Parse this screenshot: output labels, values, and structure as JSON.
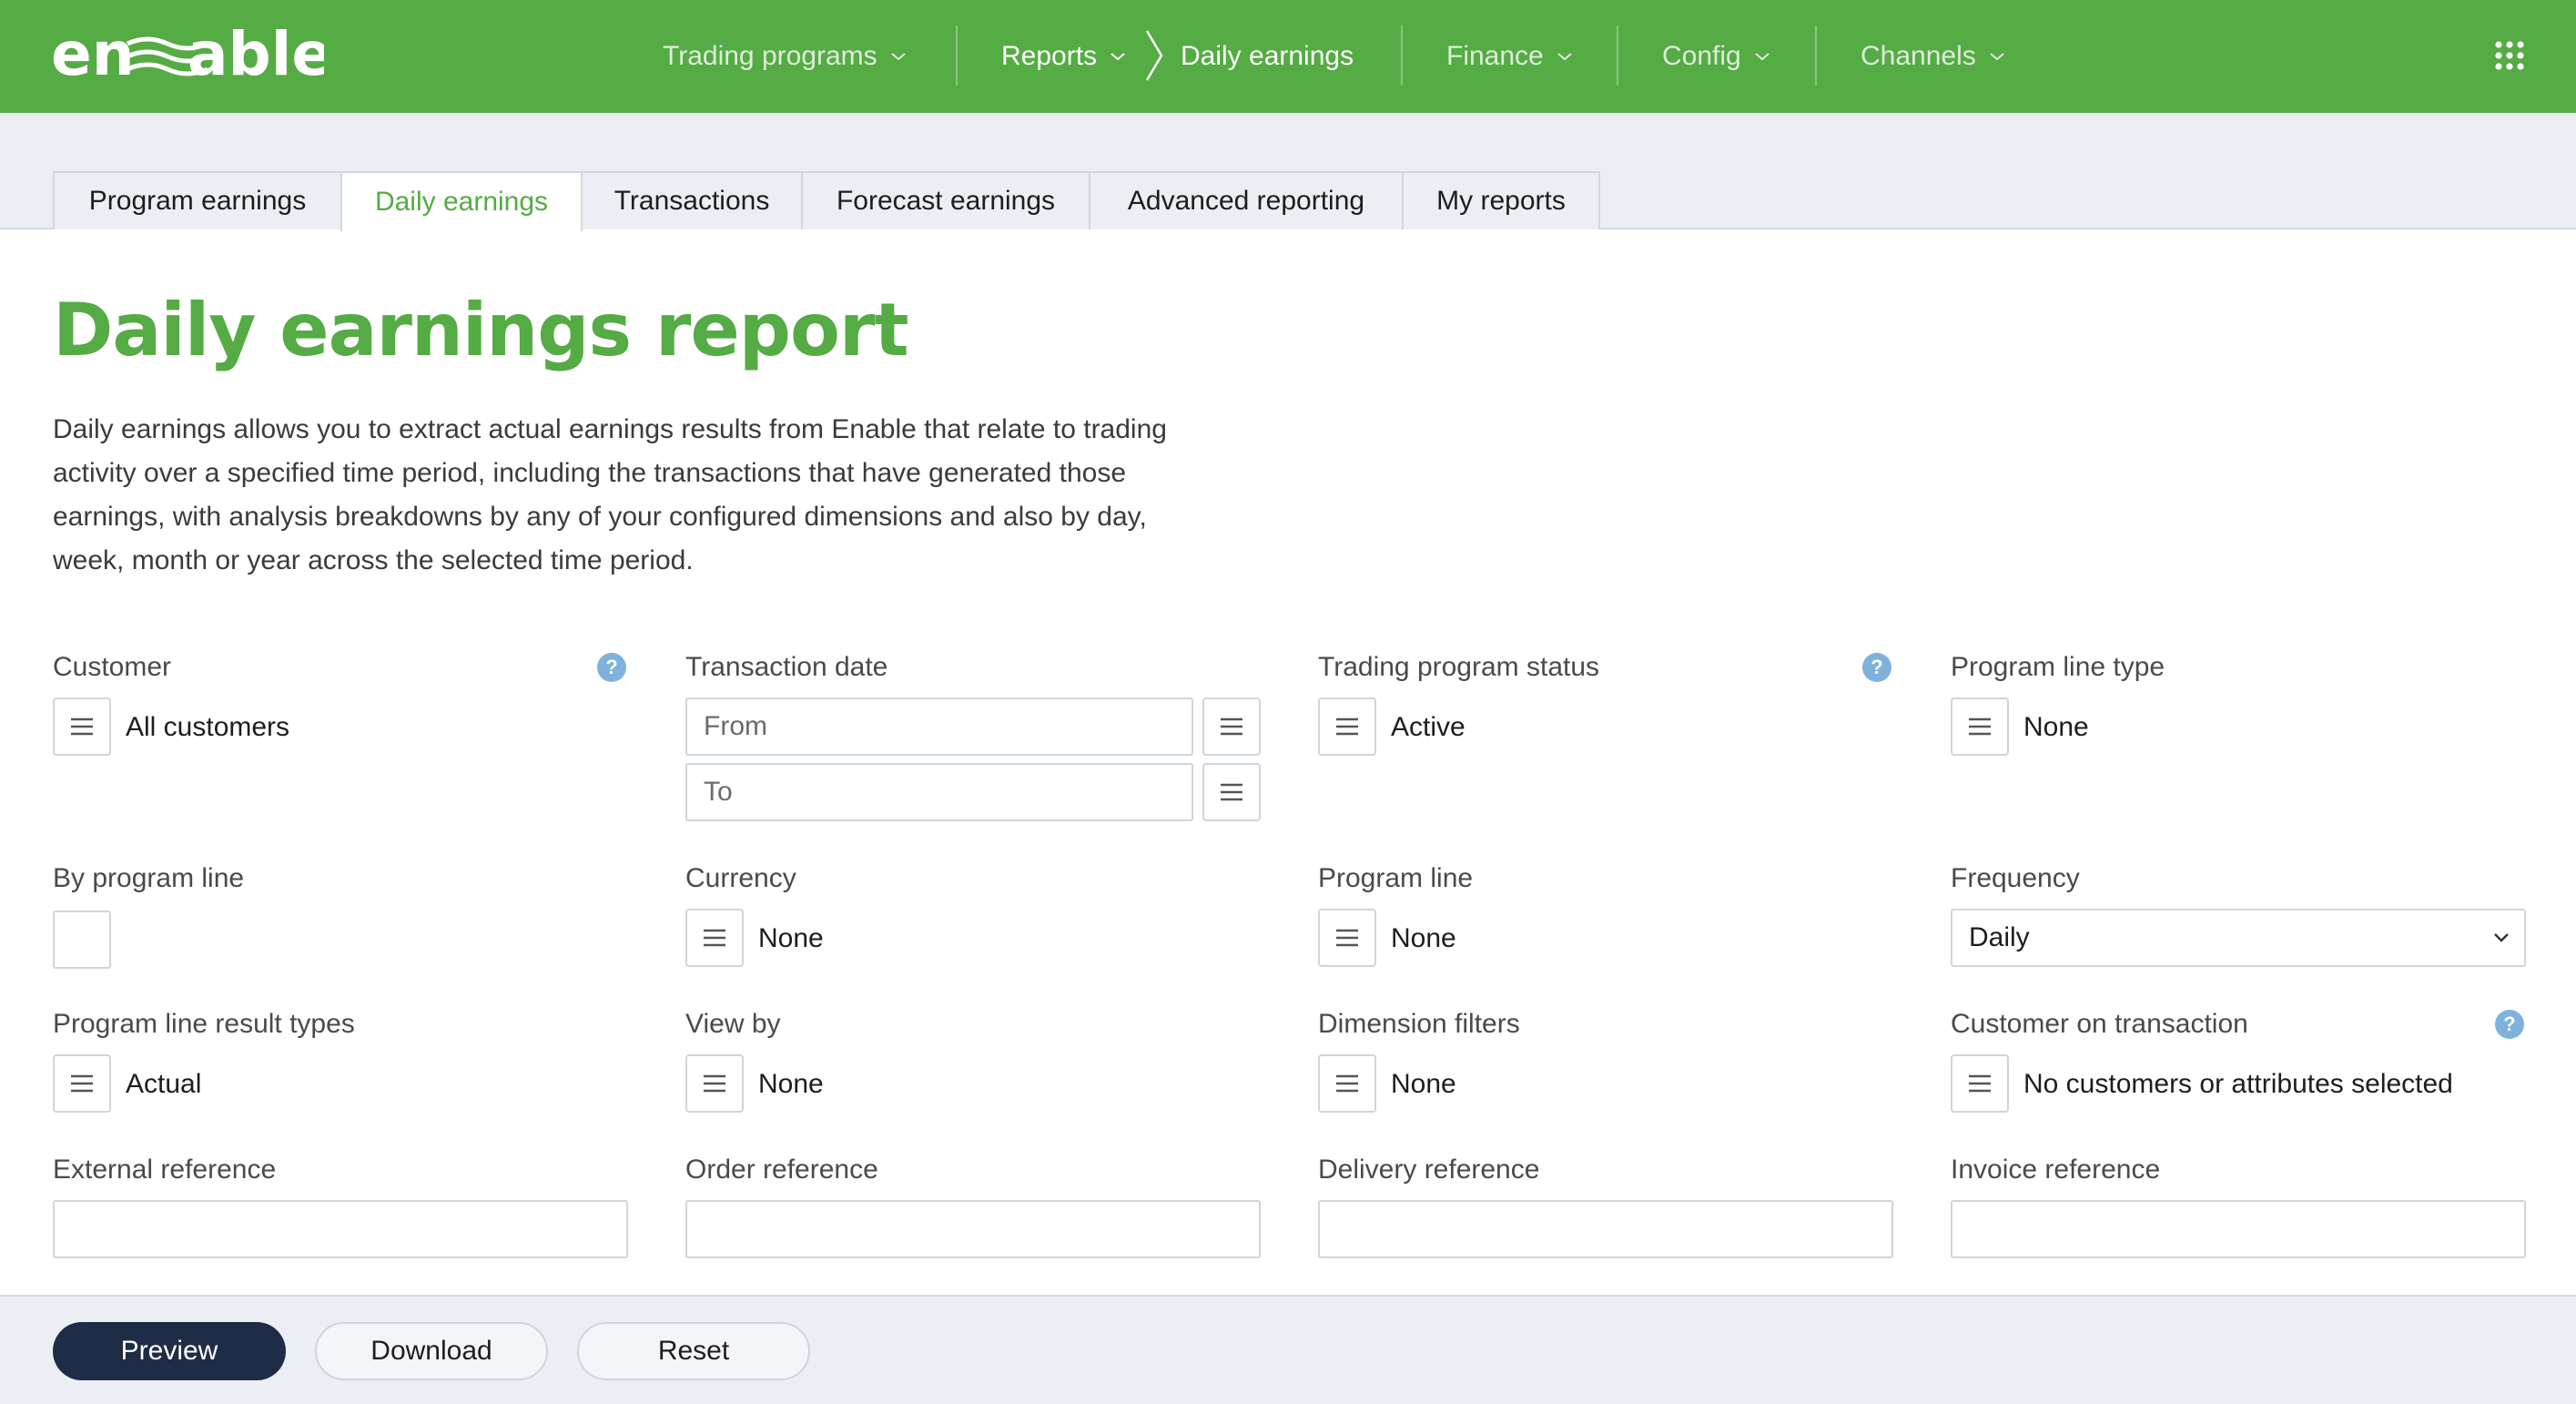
{
  "brand": {
    "name": "enable",
    "color": "#55ab44"
  },
  "nav": {
    "trading_programs": "Trading programs",
    "reports": "Reports",
    "current": "Daily earnings",
    "finance": "Finance",
    "config": "Config",
    "channels": "Channels",
    "apps_icon": "grid-icon"
  },
  "tabs": [
    {
      "label": "Program earnings"
    },
    {
      "label": "Daily earnings",
      "active": true
    },
    {
      "label": "Transactions"
    },
    {
      "label": "Forecast earnings"
    },
    {
      "label": "Advanced reporting"
    },
    {
      "label": "My reports"
    }
  ],
  "page": {
    "title": "Daily earnings report",
    "description": "Daily earnings allows you to extract actual earnings results from Enable that relate to trading activity over a specified time period, including the transactions that have generated those earnings, with analysis breakdowns by any of your configured dimensions and also by day, week, month or year across the selected time period."
  },
  "form": {
    "customer": {
      "label": "Customer",
      "value": "All customers"
    },
    "transaction_date": {
      "label": "Transaction date",
      "from_placeholder": "From",
      "to_placeholder": "To"
    },
    "trading_program_status": {
      "label": "Trading program status",
      "value": "Active"
    },
    "program_line_type": {
      "label": "Program line type",
      "value": "None"
    },
    "by_program_line": {
      "label": "By program line"
    },
    "currency": {
      "label": "Currency",
      "value": "None"
    },
    "program_line": {
      "label": "Program line",
      "value": "None"
    },
    "frequency": {
      "label": "Frequency",
      "value": "Daily"
    },
    "program_line_result_types": {
      "label": "Program line result types",
      "value": "Actual"
    },
    "view_by": {
      "label": "View by",
      "value": "None"
    },
    "dimension_filters": {
      "label": "Dimension filters",
      "value": "None"
    },
    "customer_on_transaction": {
      "label": "Customer on transaction",
      "value": "No customers or attributes selected"
    },
    "external_reference": {
      "label": "External reference",
      "value": ""
    },
    "order_reference": {
      "label": "Order reference",
      "value": ""
    },
    "delivery_reference": {
      "label": "Delivery reference",
      "value": ""
    },
    "invoice_reference": {
      "label": "Invoice reference",
      "value": ""
    },
    "help_glyph": "?"
  },
  "actions": {
    "preview": "Preview",
    "download": "Download",
    "reset": "Reset"
  },
  "colors": {
    "accent": "#55ab44",
    "primary_button": "#1f2c45",
    "help": "#7eb2dc"
  }
}
